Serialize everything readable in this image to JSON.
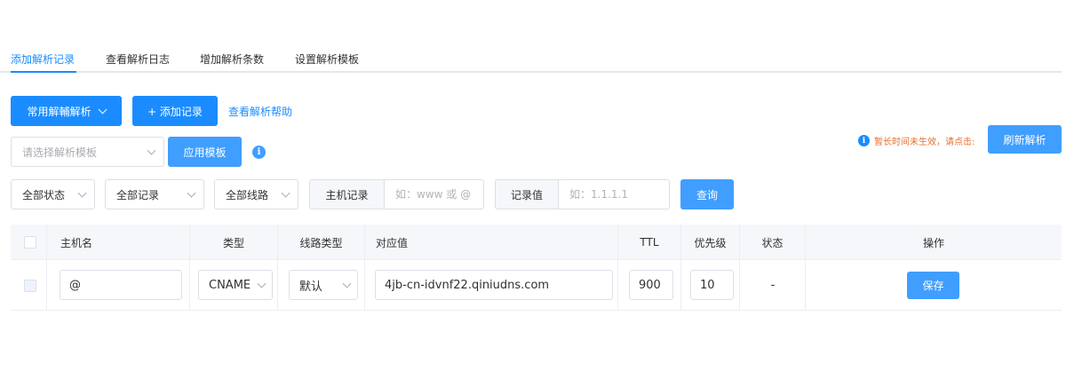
{
  "tabs": [
    {
      "label": "添加解析记录",
      "active": true
    },
    {
      "label": "查看解析日志",
      "active": false
    },
    {
      "label": "增加解析条数",
      "active": false
    },
    {
      "label": "设置解析模板",
      "active": false
    }
  ],
  "toolbar": {
    "common_resolve_label": "常用解輔解析",
    "add_record_label": "+ 添加记录",
    "help_link": "查看解析帮助"
  },
  "template": {
    "placeholder": "请选择解析模板",
    "apply_label": "应用模板",
    "info_icon": "info-icon"
  },
  "notice": {
    "text": "暂长时间未生效，请点击:",
    "refresh_label": "刷新解析",
    "color": "#e6702e"
  },
  "filters": {
    "status": "全部状态",
    "records": "全部记录",
    "lines": "全部线路",
    "host_label": "主机记录",
    "host_placeholder": "如：www 或 @",
    "value_label": "记录值",
    "value_placeholder": "如：1.1.1.1",
    "query_label": "查询"
  },
  "table": {
    "columns": [
      "主机名",
      "类型",
      "线路类型",
      "对应值",
      "TTL",
      "优先级",
      "状态",
      "操作"
    ],
    "rows": [
      {
        "host": "@",
        "type": "CNAME",
        "line": "默认",
        "value": "4jb-cn-idvnf22.qiniudns.com",
        "ttl": "900",
        "priority": "10",
        "status": "-",
        "action": "保存"
      }
    ]
  },
  "colors": {
    "accent": "#1a8cff",
    "button": "#409eff"
  }
}
